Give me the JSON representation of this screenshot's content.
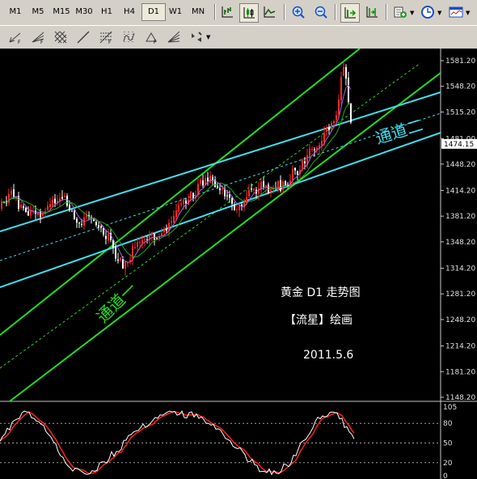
{
  "timeframes": [
    {
      "label": "M1",
      "active": false
    },
    {
      "label": "M5",
      "active": false
    },
    {
      "label": "M15",
      "active": false
    },
    {
      "label": "M30",
      "active": false
    },
    {
      "label": "H1",
      "active": false
    },
    {
      "label": "H4",
      "active": false
    },
    {
      "label": "D1",
      "active": true
    },
    {
      "label": "W1",
      "active": false
    },
    {
      "label": "MN",
      "active": false
    }
  ],
  "toolbar_icons": [
    "bar-chart-icon",
    "candlestick-icon",
    "line-chart-icon",
    "zoom-in-icon",
    "zoom-out-icon",
    "chart-shift-icon",
    "auto-scroll-icon",
    "indicators-icon",
    "periods-icon",
    "templates-icon"
  ],
  "drawing_icons": [
    "andrews-pitchfork-icon",
    "fibo-fan-icon",
    "gann-grid-icon",
    "gann-line-icon",
    "fibo-retracement-icon",
    "cycle-lines-icon",
    "triangle-icon",
    "gann-fan-icon",
    "arrows-icon"
  ],
  "chart": {
    "symbol": "黄金",
    "period": "D1",
    "title_suffix": "走势图",
    "author": "【流星】绘画",
    "date": "2011.5.6",
    "channel1_label": "通道一",
    "channel2_label": "通道二",
    "current_price": "1474.15",
    "partial_price": "1481.00",
    "colors": {
      "bull": "#ff2a2a",
      "bear": "#ffffff",
      "channel": "#22dd22",
      "channel2": "#44ddee",
      "ma": "#b060d0",
      "stoch_main": "#ff2020",
      "stoch_signal": "#30c0ff"
    }
  },
  "chart_data": {
    "type": "candlestick",
    "ylim": [
      1148.2,
      1581.2
    ],
    "y_ticks": [
      "1581.20",
      "1548.20",
      "1515.20",
      "1481.00",
      "1448.20",
      "1414.20",
      "1381.20",
      "1348.20",
      "1314.20",
      "1281.20",
      "1248.20",
      "1214.20",
      "1181.20",
      "1148.20"
    ],
    "stoch_ticks": [
      "105",
      "80",
      "50",
      "20",
      "0"
    ],
    "stoch_ylim": [
      0,
      105
    ]
  }
}
